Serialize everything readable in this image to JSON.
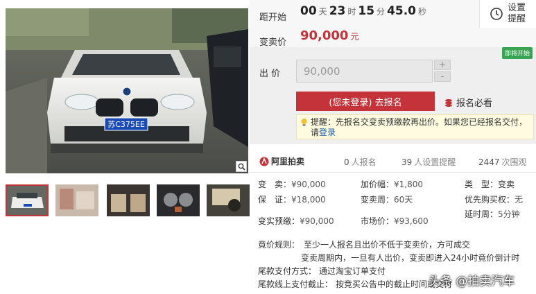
{
  "countdown": {
    "label": "距开始",
    "days": "00",
    "days_unit": "天",
    "hours": "23",
    "hours_unit": "时",
    "minutes": "15",
    "minutes_unit": "分",
    "seconds": "45.0",
    "seconds_unit": "秒"
  },
  "remind": {
    "label": "设置提醒",
    "icon": "clock-icon"
  },
  "price": {
    "label": "变卖价",
    "value": "90,000",
    "unit": "元"
  },
  "status_badge": "即将开始",
  "bid": {
    "label": "出 价",
    "value": "90,000",
    "plus": "+",
    "minus": "-",
    "signup_button": "(您未登录) 去报名",
    "must_read": "报名必看",
    "tip_title": "提醒：",
    "tip_text": "先报名交变卖预缴款再出价。如果您已经报名交付，请",
    "tip_link": "登录"
  },
  "platform": {
    "logo_text": "阿里拍卖",
    "signups_num": "0",
    "signups_label": "人报名",
    "reminders_num": "39",
    "reminders_label": "人设置提醒",
    "views_num": "2447",
    "views_label": "次围观"
  },
  "details": {
    "sell_label": "变　卖：",
    "sell_value": "¥90,000",
    "deposit_label": "保　证：",
    "deposit_value": "¥18,000",
    "prepay_label": "变实预缴：",
    "prepay_value": "¥90,000",
    "increment_label": "加价幅：",
    "increment_value": "¥1,800",
    "period_label": "变卖周：",
    "period_value": "60天",
    "market_label": "市场价：",
    "market_value": "¥93,600",
    "type_label": "类　型：",
    "type_value": "变卖",
    "priority_label": "优先购买权：",
    "priority_value": "无",
    "delay_label": "延时周：",
    "delay_value": "5分钟"
  },
  "rules": {
    "title": "竟价规则：",
    "line1": "至少一人报名且出价不低于变卖价，方可成交",
    "line2": "变卖周期内，一旦有人出价，变卖即进入24小时竟价倒计时",
    "pay_label": "尾款支付方式：",
    "pay_value": "通过淘宝订单支付",
    "deadline_label": "尾款线上支付截止：",
    "deadline_value": "按竞买公告中的截止时间或交付"
  },
  "watermark": "头条 @拍卖汽车",
  "plate_text": "苏C375EE",
  "colors": {
    "accent": "#c4323a",
    "badge": "#3aa455",
    "link": "#1d5fa8",
    "tip_bg": "#fffbe0"
  }
}
